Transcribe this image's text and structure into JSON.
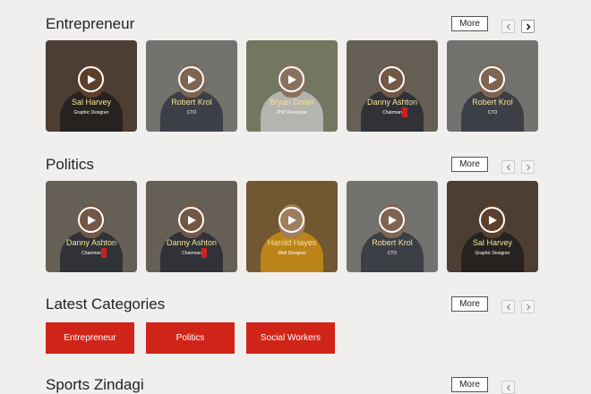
{
  "sections": [
    {
      "title": "Entrepreneur",
      "more_label": "More",
      "cards": [
        {
          "name": "Sal Harvey",
          "role": "Graphic Designer",
          "bg": "#5e4c3f",
          "skin": "#6f4d35",
          "shirt": "#2f2a27",
          "mark": false
        },
        {
          "name": "Robert Krol",
          "role": "CTO",
          "bg": "#8e8b87",
          "skin": "#9b7a64",
          "shirt": "#4a4d55",
          "mark": false
        },
        {
          "name": "Bryan Dolan",
          "role": "PHP Developer",
          "bg": "#8d9276",
          "skin": "#a98a74",
          "shirt": "#dcdcd8",
          "mark": false
        },
        {
          "name": "Danny Ashton",
          "role": "Chairman",
          "bg": "#7d7468",
          "skin": "#8d6a52",
          "shirt": "#3b3d44",
          "mark": true
        },
        {
          "name": "Robert Krol",
          "role": "CTO",
          "bg": "#8e8b87",
          "skin": "#9b7a64",
          "shirt": "#4a4d55",
          "mark": false
        }
      ]
    },
    {
      "title": "Politics",
      "more_label": "More",
      "cards": [
        {
          "name": "Danny Ashton",
          "role": "Chairman",
          "bg": "#7d7468",
          "skin": "#8d6a52",
          "shirt": "#3b3d44",
          "mark": true
        },
        {
          "name": "Danny Ashton",
          "role": "Chairman",
          "bg": "#7d7468",
          "skin": "#8d6a52",
          "shirt": "#3b3d44",
          "mark": true
        },
        {
          "name": "Harold Hayes",
          "role": "Web Designer",
          "bg": "#8a6b3e",
          "skin": "#c39a73",
          "shirt": "#e4a21e",
          "mark": false
        },
        {
          "name": "Robert Krol",
          "role": "CTO",
          "bg": "#8e8b87",
          "skin": "#9b7a64",
          "shirt": "#4a4d55",
          "mark": false
        },
        {
          "name": "Sal Harvey",
          "role": "Graphic Designer",
          "bg": "#5e4c3f",
          "skin": "#6f4d35",
          "shirt": "#2f2a27",
          "mark": false
        }
      ]
    }
  ],
  "latest": {
    "title": "Latest Categories",
    "more_label": "More",
    "buttons": [
      "Entrepreneur",
      "Politics",
      "Social Workers"
    ]
  },
  "sports": {
    "title": "Sports Zindagi",
    "more_label": "More"
  },
  "colors": {
    "accent_red": "#d02419",
    "page_bg": "#f0efee"
  }
}
